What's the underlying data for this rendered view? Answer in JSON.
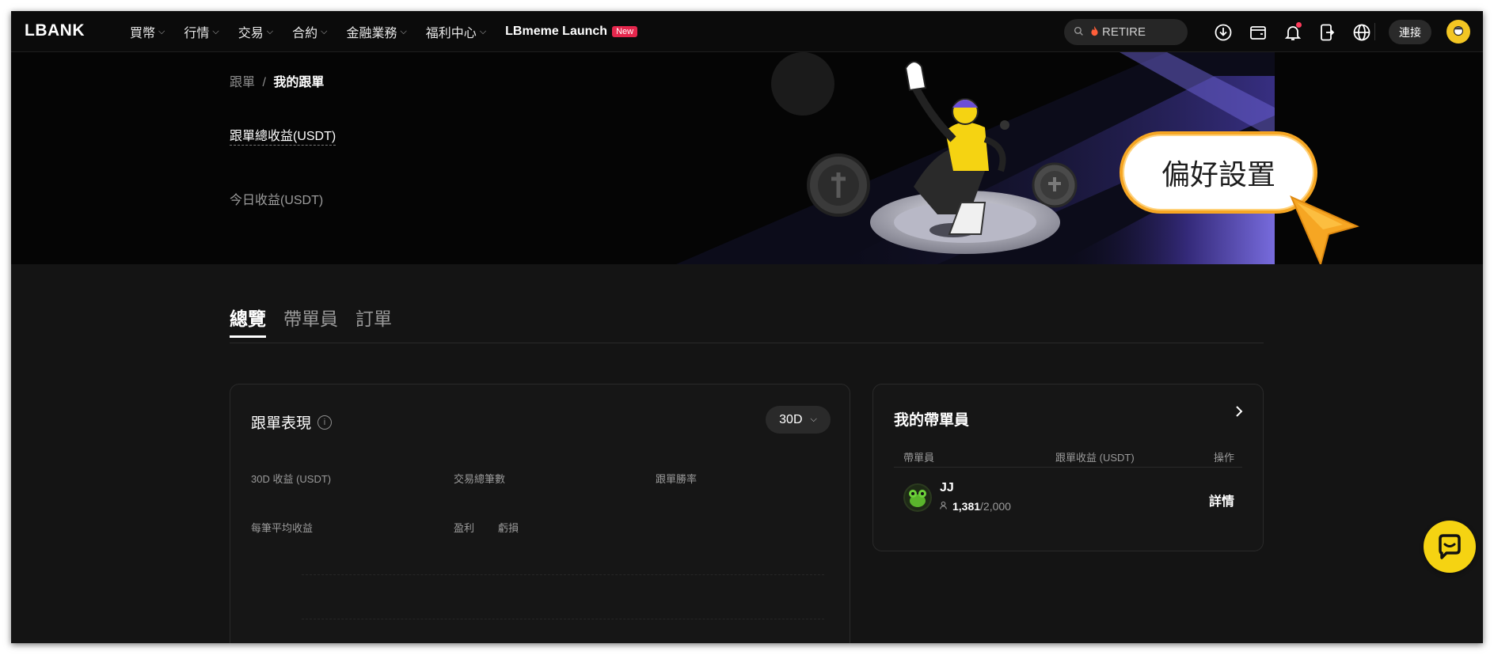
{
  "nav": {
    "logo": "LBANK",
    "menu": [
      {
        "label": "買幣",
        "chevron": true
      },
      {
        "label": "行情",
        "chevron": true
      },
      {
        "label": "交易",
        "chevron": true
      },
      {
        "label": "合約",
        "chevron": true
      },
      {
        "label": "金融業務",
        "chevron": true
      },
      {
        "label": "福利中心",
        "chevron": true
      }
    ],
    "launch_label": "LBmeme Launch",
    "launch_badge": "New",
    "search_text": "RETIRE",
    "connect_label": "連接"
  },
  "hero": {
    "breadcrumb_parent": "跟單",
    "breadcrumb_sep": "/",
    "breadcrumb_current": "我的跟單",
    "total_label": "跟單總收益(USDT)",
    "today_label": "今日收益(USDT)",
    "callout_text": "偏好設置"
  },
  "tabs": [
    {
      "label": "總覽",
      "active": true
    },
    {
      "label": "帶單員",
      "active": false
    },
    {
      "label": "訂單",
      "active": false
    }
  ],
  "performance": {
    "title": "跟單表現",
    "range": "30D",
    "stats": {
      "income_30d": "30D 收益 (USDT)",
      "trade_count": "交易總筆數",
      "win_rate": "跟單勝率",
      "avg_income": "每筆平均收益",
      "profit": "盈利",
      "loss": "虧損"
    }
  },
  "leaders": {
    "title": "我的帶單員",
    "headers": {
      "leader": "帶單員",
      "income": "跟單收益 (USDT)",
      "action": "操作"
    },
    "rows": [
      {
        "name": "JJ",
        "followers": "1,381",
        "capacity": "/2,000",
        "action": "詳情"
      }
    ]
  },
  "colors": {
    "accent": "#f5d312",
    "callout_border": "#f6a623",
    "new_badge": "#e5274d",
    "background": "#141414"
  }
}
